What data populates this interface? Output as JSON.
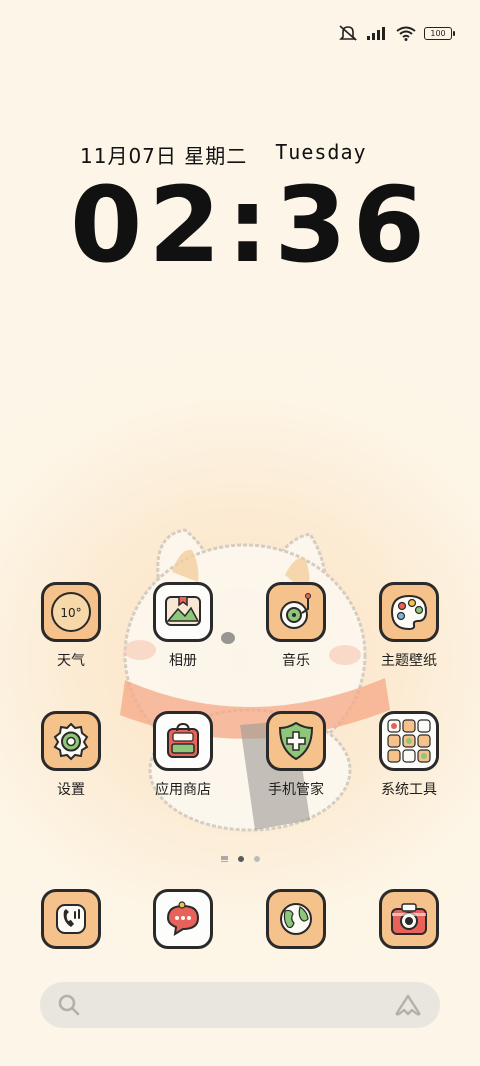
{
  "status_bar": {
    "icons": [
      "mute-icon",
      "signal-icon",
      "wifi-icon",
      "battery-icon"
    ],
    "battery_level": "100"
  },
  "clock": {
    "date": "11月07日",
    "weekday_cn": "星期二",
    "weekday_en": "Tuesday",
    "time": "02:36"
  },
  "apps": [
    {
      "label": "天气",
      "icon": "weather-icon",
      "temp": "10°"
    },
    {
      "label": "相册",
      "icon": "gallery-icon"
    },
    {
      "label": "音乐",
      "icon": "music-icon"
    },
    {
      "label": "主题壁纸",
      "icon": "theme-palette-icon"
    },
    {
      "label": "设置",
      "icon": "settings-icon"
    },
    {
      "label": "应用商店",
      "icon": "app-store-icon"
    },
    {
      "label": "手机管家",
      "icon": "security-shield-icon"
    },
    {
      "label": "系统工具",
      "icon": "system-tools-folder-icon"
    }
  ],
  "pages": {
    "count": 2,
    "active": 1
  },
  "dock": [
    {
      "icon": "phone-icon"
    },
    {
      "icon": "messages-icon"
    },
    {
      "icon": "browser-globe-icon"
    },
    {
      "icon": "camera-icon"
    }
  ],
  "search": {
    "icons": [
      "search-icon",
      "assistant-icon"
    ]
  },
  "colors": {
    "tile": "#f5c28c",
    "outline": "#2a2a2a",
    "accent_red": "#e8625a",
    "accent_green": "#8fc77a"
  }
}
